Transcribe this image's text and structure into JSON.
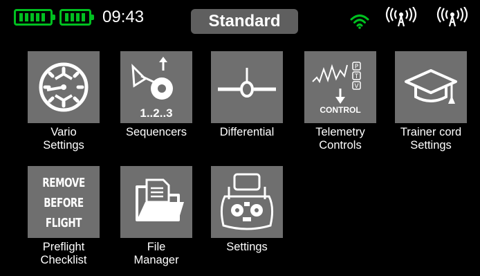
{
  "status_bar": {
    "battery_1": "battery-full-icon",
    "battery_2": "battery-full-icon",
    "time": "09:43",
    "model_mode": "Standard",
    "signal_icons": [
      "wifi-icon",
      "antenna-icon",
      "antenna-icon"
    ],
    "accent_color": "#00c020"
  },
  "menu": {
    "items": [
      {
        "label": "Vario\nSettings",
        "icon": "vario-gauge-icon"
      },
      {
        "label": "Sequencers",
        "icon": "sequencer-icon",
        "icon_text": "1..2..3"
      },
      {
        "label": "Differential",
        "icon": "differential-icon"
      },
      {
        "label": "Telemetry\nControls",
        "icon": "telemetry-control-icon",
        "icon_text": "CONTROL",
        "icon_letters": [
          "P",
          "T",
          "V"
        ]
      },
      {
        "label": "Trainer cord\nSettings",
        "icon": "graduation-cap-icon"
      },
      {
        "label": "Preflight\nChecklist",
        "icon": "remove-before-flight-icon",
        "icon_text": "REMOVE\nBEFORE\nFLIGHT"
      },
      {
        "label": "File\nManager",
        "icon": "folder-icon"
      },
      {
        "label": "Settings",
        "icon": "transmitter-icon"
      }
    ]
  }
}
